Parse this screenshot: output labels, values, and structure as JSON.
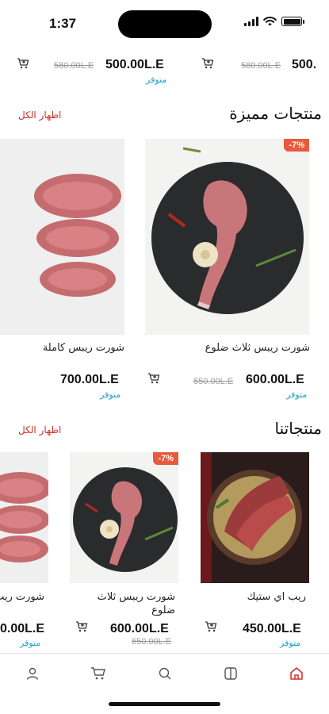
{
  "status": {
    "time": "1:37"
  },
  "top_strip": {
    "items": [
      {
        "price": "500.00L.E",
        "old_price": "580.00L.E",
        "availability": "متوفر"
      },
      {
        "price": "500.",
        "old_price": "580.00L.E"
      }
    ]
  },
  "featured": {
    "title": "منتجات مميزة",
    "show_all": "اظهار الكل",
    "products": [
      {
        "name": "شورت ريبس ثلاث ضلوع",
        "price": "600.00L.E",
        "old_price": "650.00L.E",
        "availability": "متوفر",
        "badge": "-7%"
      },
      {
        "name": "شورت ريبس كاملة",
        "price": "700.00L.E",
        "availability": "متوفر"
      }
    ]
  },
  "ours": {
    "title": "منتجاتنا",
    "show_all": "اظهار الكل",
    "products": [
      {
        "name": "ريب اي ستيك",
        "price": "450.00L.E",
        "availability": "متوفر"
      },
      {
        "name_line1": "شورت ريبس ثلاث",
        "name_line2": "ضلوع",
        "price": "600.00L.E",
        "old_price": "650.00L.E",
        "badge": "-7%"
      },
      {
        "name": "شورت ريب",
        "price": "0.00L.E",
        "availability": "متوفر"
      }
    ]
  },
  "nav": {
    "items": [
      "profile-icon",
      "cart-icon",
      "search-icon",
      "catalog-icon",
      "home-icon"
    ],
    "active": "home-icon",
    "active_color": "#d0302b",
    "inactive_color": "#555555"
  },
  "colors": {
    "accent": "#d0302b",
    "available": "#1aa3c4",
    "badge": "#e85a3c"
  }
}
